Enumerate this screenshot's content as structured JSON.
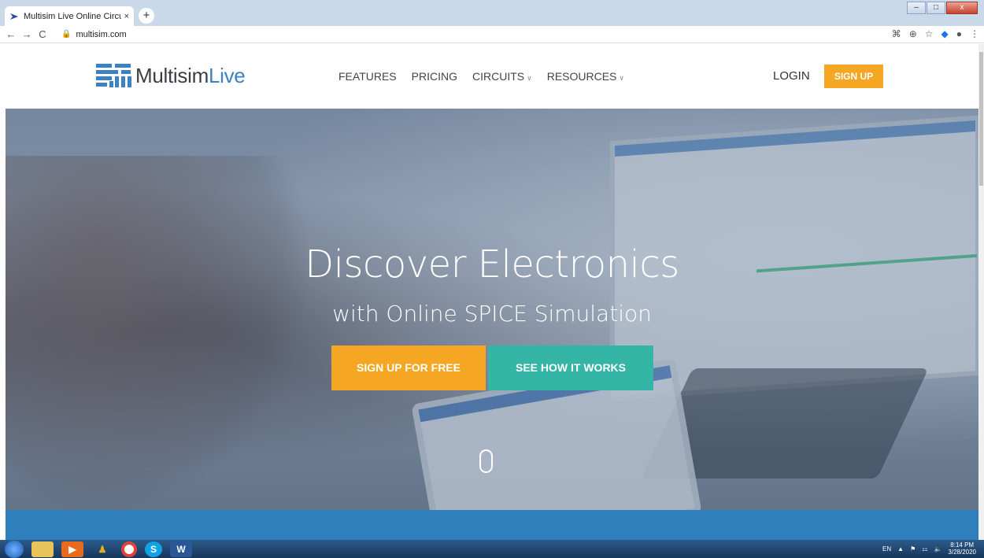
{
  "browser": {
    "tab_title": "Multisim Live Online Circuit Simu",
    "tab_close": "×",
    "new_tab": "+",
    "url": "multisim.com",
    "back": "←",
    "forward": "→",
    "reload": "C"
  },
  "site": {
    "logo_main": "Multisim",
    "logo_accent": "Live",
    "nav": [
      "FEATURES",
      "PRICING",
      "CIRCUITS",
      "RESOURCES"
    ],
    "login": "LOGIN",
    "signup": "SIGN UP"
  },
  "hero": {
    "title": "Discover Electronics",
    "subtitle": "with Online SPICE Simulation",
    "primary_button": "SIGN UP FOR FREE",
    "secondary_button": "SEE HOW IT WORKS"
  },
  "taskbar": {
    "language": "EN",
    "time": "8:14 PM",
    "date": "3/28/2020"
  },
  "colors": {
    "accent_orange": "#f5a623",
    "accent_teal": "#35b5a5",
    "brand_blue": "#3b82c4"
  }
}
